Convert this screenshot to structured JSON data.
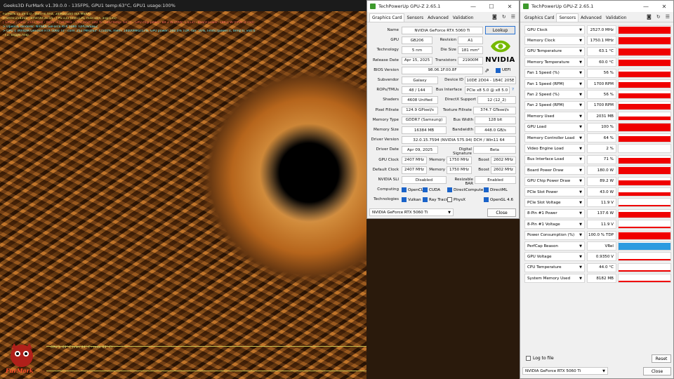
{
  "furmark": {
    "title": "Geeks3D FurMark v1.39.0.0 - 135FPS, GPU1 temp:63°C, GPU1 usage:100%",
    "overlay_lines": [
      "FurMark v1.39.0.0 - Burn-in test, 3840x2160 (8X MSAA)",
      "Frames:258318 - time:00:31:55 - FPS:135 (min:126, max:187, avg:135)",
      "[ GPU-Z ] core: 2527 MHz - mem: 1750 MHz - GPU load: 100 % - GPU temp: 63 °C - GPU chip power: 89.2 W (PPW: 1.513) - Board power: 180.0 W (PPW: 0.750) - GPU voltage: 0.935 V",
      "> OpenGL renderer: NVIDIA GeForce RTX 5060 Ti/PCIe/SSE2",
      "> GPU 1 (NVIDIA GeForce RTX 5060 Ti) - core: 2527MHz/63° C/100%, mem: 14000MHz/12%, GPU power: 100.0% TDP, fan: 56%, limits:[power:1, temp:0, volt:0, OV:0]",
      "- F1: toggle help"
    ],
    "graph_label": "GPU 1: 63° C (min: 44° C - max: 63° C)",
    "logo_text": "FurMark"
  },
  "gpuz_main": {
    "title": "TechPowerUp GPU-Z 2.65.1",
    "tabs": [
      "Graphics Card",
      "Sensors",
      "Advanced",
      "Validation"
    ],
    "lookup_label": "Lookup",
    "vendor_logo": "NVIDIA",
    "fields": {
      "name_label": "Name",
      "name": "NVIDIA GeForce RTX 5060 Ti",
      "gpu_label": "GPU",
      "gpu": "GB206",
      "revision_label": "Revision",
      "revision": "A1",
      "technology_label": "Technology",
      "technology": "5 nm",
      "die_size_label": "Die Size",
      "die_size": "181 mm²",
      "release_label": "Release Date",
      "release": "Apr 15, 2025",
      "transistors_label": "Transistors",
      "transistors": "21900M",
      "bios_label": "BIOS Version",
      "bios": "98.06.1F.00.8F",
      "uefi_label": "UEFI",
      "subvendor_label": "Subvendor",
      "subvendor": "Galaxy",
      "device_id_label": "Device ID",
      "device_id": "10DE 2D04 - 1B4C 205E",
      "rops_label": "ROPs/TMUs",
      "rops": "48 / 144",
      "bus_label": "Bus Interface",
      "bus": "PCIe x8 5.0 @ x8 5.0",
      "shaders_label": "Shaders",
      "shaders": "4608 Unified",
      "directx_label": "DirectX Support",
      "directx": "12 (12_2)",
      "pixel_label": "Pixel Fillrate",
      "pixel": "124.9 GPixel/s",
      "texture_label": "Texture Fillrate",
      "texture": "374.7 GTexel/s",
      "memtype_label": "Memory Type",
      "memtype": "GDDR7 (Samsung)",
      "buswidth_label": "Bus Width",
      "buswidth": "128 bit",
      "memsize_label": "Memory Size",
      "memsize": "16384 MB",
      "bandwidth_label": "Bandwidth",
      "bandwidth": "448.0 GB/s",
      "driver_label": "Driver Version",
      "driver": "32.0.15.7594 (NVIDIA 575.94) DCH / Win11 64",
      "driverdate_label": "Driver Date",
      "driverdate": "Apr 09, 2025",
      "sig_label": "Digital Signature",
      "sig": "Beta",
      "gpuclock_label": "GPU Clock",
      "gpuclock": "2407 MHz",
      "mem_label": "Memory",
      "memclock": "1750 MHz",
      "boost_label": "Boost",
      "boost": "2602 MHz",
      "defclock_label": "Default Clock",
      "defclock": "2407 MHz",
      "defmem": "1750 MHz",
      "defboost": "2602 MHz",
      "sli_label": "NVIDIA SLI",
      "sli": "Disabled",
      "rebar_label": "Resizable BAR",
      "rebar": "Enabled",
      "computing_label": "Computing",
      "technologies_label": "Technologies",
      "computing": [
        "OpenCL",
        "CUDA",
        "DirectCompute",
        "DirectML"
      ],
      "technologies": [
        "Vulkan",
        "Ray Tracing",
        "PhysX",
        "OpenGL 4.6"
      ]
    },
    "select_value": "NVIDIA GeForce RTX 5060 Ti",
    "close_label": "Close"
  },
  "gpuz_sensors": {
    "title": "TechPowerUp GPU-Z 2.65.1",
    "tabs": [
      "Graphics Card",
      "Sensors",
      "Advanced",
      "Validation"
    ],
    "sensors": [
      {
        "name": "GPU Clock",
        "value": "2527.0 MHz",
        "level": 0.95
      },
      {
        "name": "Memory Clock",
        "value": "1750.1 MHz",
        "level": 0.95
      },
      {
        "name": "GPU Temperature",
        "value": "63.1 °C",
        "level": 0.85
      },
      {
        "name": "Memory Temperature",
        "value": "60.0 °C",
        "level": 0.8
      },
      {
        "name": "Fan 1 Speed (%)",
        "value": "56 %",
        "level": 0.7
      },
      {
        "name": "Fan 1 Speed (RPM)",
        "value": "1700 RPM",
        "level": 0.7
      },
      {
        "name": "Fan 2 Speed (%)",
        "value": "56 %",
        "level": 0.7
      },
      {
        "name": "Fan 2 Speed (RPM)",
        "value": "1700 RPM",
        "level": 0.7
      },
      {
        "name": "Memory Used",
        "value": "2031 MB",
        "level": 0.5
      },
      {
        "name": "GPU Load",
        "value": "100 %",
        "level": 0.95
      },
      {
        "name": "Memory Controller Load",
        "value": "64 %",
        "level": 0.7
      },
      {
        "name": "Video Engine Load",
        "value": "2 %",
        "level": 0.0
      },
      {
        "name": "Bus Interface Load",
        "value": "71 %",
        "level": 0.75
      },
      {
        "name": "Board Power Draw",
        "value": "180.0 W",
        "level": 0.9
      },
      {
        "name": "GPU Chip Power Draw",
        "value": "89.2 W",
        "level": 0.6
      },
      {
        "name": "PCIe Slot Power",
        "value": "43.0 W",
        "level": 0.5
      },
      {
        "name": "PCIe Slot Voltage",
        "value": "11.9 V",
        "level": 0.2
      },
      {
        "name": "8-Pin #1 Power",
        "value": "137.6 W",
        "level": 0.75
      },
      {
        "name": "8-Pin #1 Voltage",
        "value": "11.9 V",
        "level": 0.2
      },
      {
        "name": "Power Consumption (%)",
        "value": "100.0 % TDP",
        "level": 0.9
      },
      {
        "name": "PerfCap Reason",
        "value": "VRel",
        "level": 0.9,
        "color": "#2b9be0"
      },
      {
        "name": "GPU Voltage",
        "value": "0.9350 V",
        "level": 0.2
      },
      {
        "name": "CPU Temperature",
        "value": "44.0 °C",
        "level": 0.2
      },
      {
        "name": "System Memory Used",
        "value": "8182 MB",
        "level": 0.2
      }
    ],
    "log_label": "Log to file",
    "reset_label": "Reset",
    "select_value": "NVIDIA GeForce RTX 5060 Ti",
    "close_label": "Close"
  }
}
